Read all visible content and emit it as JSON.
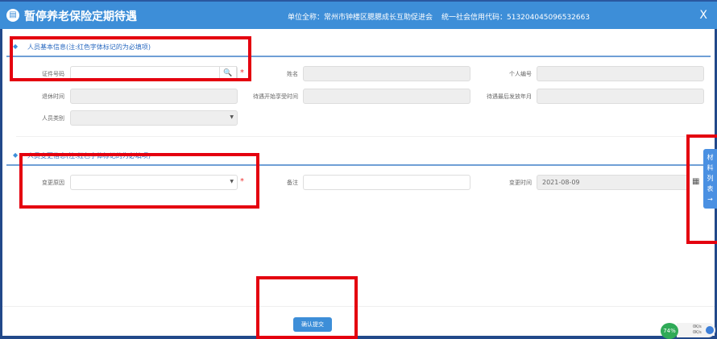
{
  "header": {
    "title": "暂停养老保险定期待遇",
    "unit_label": "单位全称：常州市钟楼区腮腮成长互助促进会",
    "credit_label": "统一社会信用代码：513204045096532663",
    "close": "X"
  },
  "section1": {
    "title": "人员基本信息(注:红色字体标记的为必填项)",
    "fields": [
      {
        "label": "证件号码",
        "value": ""
      },
      {
        "label": "姓名",
        "value": ""
      },
      {
        "label": "个人编号",
        "value": ""
      },
      {
        "label": "退休时间",
        "value": ""
      },
      {
        "label": "待遇开始享受时间",
        "value": ""
      },
      {
        "label": "待遇最后发放年月",
        "value": ""
      },
      {
        "label": "人员类别",
        "value": ""
      }
    ]
  },
  "section2": {
    "title": "人员变更信息(注:红色字体标记的为必填项)",
    "fields": [
      {
        "label": "变更原因",
        "value": ""
      },
      {
        "label": "备注",
        "value": ""
      },
      {
        "label": "变更时间",
        "value": "2021-08-09"
      }
    ]
  },
  "side_tab": {
    "label": "材料列表",
    "arrow": "→"
  },
  "submit_label": "确认提交",
  "tray": {
    "gauge": "74%",
    "up": "0K/s",
    "down": "0K/s"
  },
  "required_mark": "*"
}
